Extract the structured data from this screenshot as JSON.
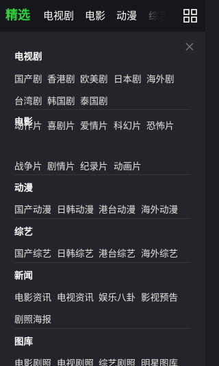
{
  "nav": {
    "tabs": [
      {
        "label": "精选",
        "active": true
      },
      {
        "label": "电视剧"
      },
      {
        "label": "电影"
      },
      {
        "label": "动漫"
      },
      {
        "label": "综艺"
      }
    ],
    "grid_icon": "grid-icon",
    "accent_color": "#2fd33f"
  },
  "panel": {
    "close_icon": "close-icon",
    "sections": [
      {
        "title": "电视剧",
        "rows": [
          [
            "国产剧",
            "香港剧",
            "欧美剧",
            "日本剧",
            "海外剧"
          ],
          [
            "台湾剧",
            "韩国剧",
            "泰国剧"
          ]
        ]
      },
      {
        "title": "电影",
        "rows": [
          [
            "动作片",
            "喜剧片",
            "爱情片",
            "科幻片",
            "恐怖片"
          ],
          [
            "战争片",
            "剧情片",
            "纪录片",
            "动画片"
          ]
        ]
      },
      {
        "title": "动漫",
        "rows": [
          [
            "国产动漫",
            "日韩动漫",
            "港台动漫",
            "海外动漫"
          ]
        ]
      },
      {
        "title": "综艺",
        "rows": [
          [
            "国产综艺",
            "日韩综艺",
            "港台综艺",
            "海外综艺"
          ]
        ]
      },
      {
        "title": "新闻",
        "rows": [
          [
            "电影资讯",
            "电视资讯",
            "娱乐八卦",
            "影视预告"
          ],
          [
            "剧照海报"
          ]
        ]
      },
      {
        "title": "图库",
        "rows": [
          [
            "电影剧照",
            "电视剧照",
            "综艺剧照",
            "明星图库"
          ]
        ]
      }
    ]
  }
}
